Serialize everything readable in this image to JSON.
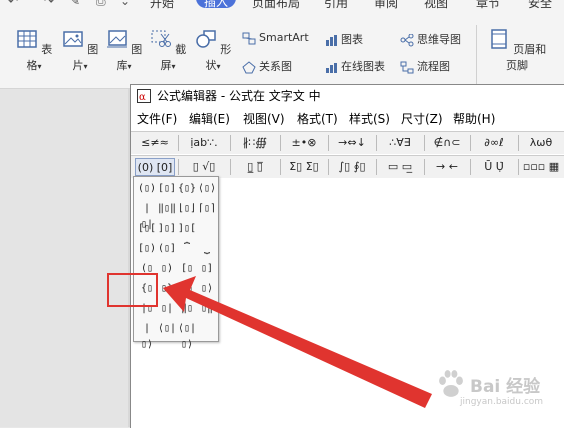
{
  "tabs": [
    "开始",
    "插入",
    "页面布局",
    "引用",
    "审阅",
    "视图",
    "章节",
    "安全"
  ],
  "active_tab": "插入",
  "ribbon": {
    "table": "表格",
    "picture": "图片",
    "gallery": "图库",
    "screenshot": "截屏",
    "shapes": "形状",
    "smartart": "SmartArt",
    "relation": "关系图",
    "chart": "图表",
    "online_chart": "在线图表",
    "mindmap": "思维导图",
    "flowchart": "流程图",
    "header_footer": "页眉和页脚",
    "dropdown_arrow": "▾"
  },
  "editor": {
    "title": "公式编辑器 - 公式在 文字文 中",
    "menu": [
      "文件(F)",
      "编辑(E)",
      "视图(V)",
      "格式(T)",
      "样式(S)",
      "尺寸(Z)",
      "帮助(H)"
    ],
    "toolbar1": [
      "≤≠≈",
      "ịab∵.",
      "∦∷∰",
      "±•⊗",
      "→⇔↓",
      "∴∀∃",
      "∉∩⊂",
      "∂∞ℓ",
      "λωθ"
    ],
    "toolbar2": [
      "(0) [0]",
      "▯ √▯",
      "▯̲ ▯̅",
      "Σ▯ Σ▯",
      "∫▯ ∮▯",
      "▭ ▭̲",
      "→ ←",
      "Ū Ụ̇",
      "▫▫▫ ▦"
    ],
    "palette": [
      [
        "(▯)",
        "[▯]",
        "{▯}",
        "⟨▯⟩"
      ],
      [
        "|▯|",
        "‖▯‖",
        "⌊▯⌋",
        "⌈▯⌉"
      ],
      [
        "[▯[",
        "]▯]",
        "]▯[",
        ""
      ],
      [
        "[▯)",
        "(▯]",
        "⏞",
        "⏟"
      ],
      [
        "(▯",
        "▯)",
        "[▯",
        "▯]"
      ],
      [
        "{▯",
        "▯}",
        "⟨▯",
        "▯⟩"
      ],
      [
        "|▯",
        "▯|",
        "‖▯",
        "▯‖"
      ],
      [
        "|▯⟩",
        "⟨▯|",
        "⟨▯|▯⟩",
        ""
      ]
    ]
  },
  "watermark": {
    "text": "Bai 经验",
    "url": "jingyan.baidu.com"
  },
  "colors": {
    "accent": "#4c72d9",
    "arrow": "#e0342f"
  }
}
